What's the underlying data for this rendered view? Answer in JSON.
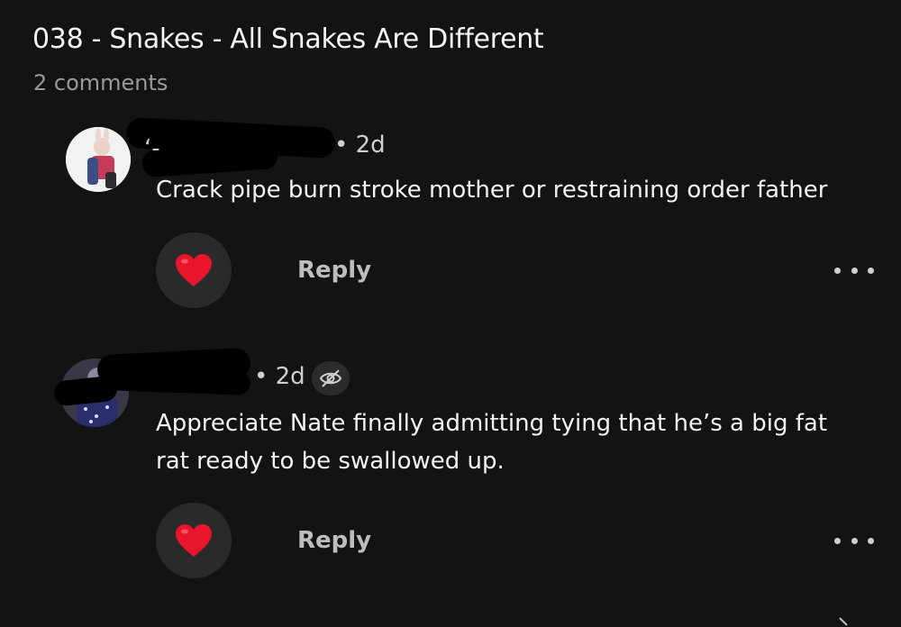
{
  "post": {
    "title": "038 - Snakes - All Snakes Are Different",
    "comment_count": "2 comments"
  },
  "comments": [
    {
      "username_visible": "‘-",
      "separator": "•",
      "age": "2d",
      "text": "Crack pipe burn stroke mother or restraining order father",
      "reply_label": "Reply",
      "like_icon": "heart-icon",
      "more_icon": "more-icon"
    },
    {
      "username_visible": "",
      "separator": "•",
      "age": "2d",
      "hidden_icon": "eye-off-icon",
      "text": "Appreciate Nate finally admitting tying that he’s a big fat rat ready to be swallowed up.",
      "reply_label": "Reply",
      "like_icon": "heart-icon",
      "more_icon": "more-icon"
    }
  ],
  "colors": {
    "background": "#131313",
    "heart": "#e8152b",
    "like_button_bg": "#2a2a2a"
  }
}
